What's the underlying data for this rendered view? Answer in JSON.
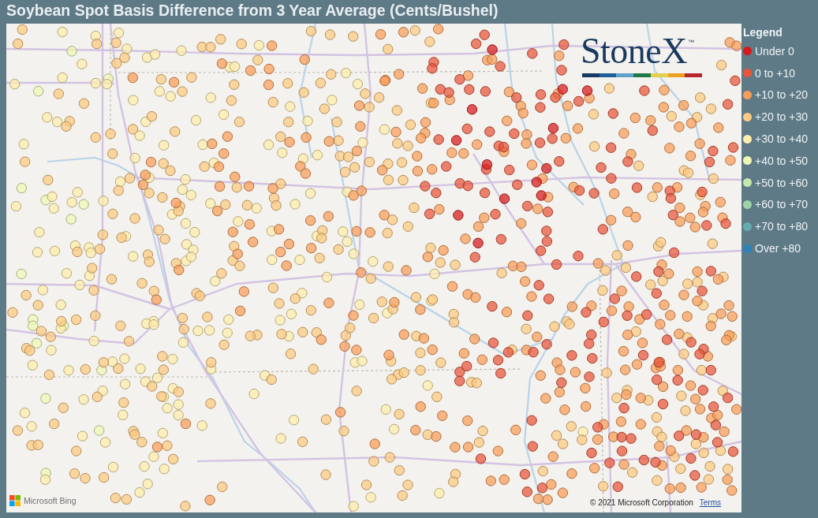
{
  "title": "Soybean Spot Basis Difference from 3 Year Average (Cents/Bushel)",
  "map": {
    "logo": {
      "wordmark": "StoneX",
      "trademark": "™"
    },
    "attribution": {
      "provider": "Microsoft Bing",
      "copyright": "© 2021 Microsoft Corporation",
      "link": "Terms"
    }
  },
  "legend": {
    "title": "Legend",
    "items": [
      {
        "label": "Under 0",
        "color": "#d7191c"
      },
      {
        "label": "0 to +10",
        "color": "#e8553a"
      },
      {
        "label": "+10 to +20",
        "color": "#f99d59"
      },
      {
        "label": "+20 to +30",
        "color": "#fec980"
      },
      {
        "label": "+30 to +40",
        "color": "#ffedaa"
      },
      {
        "label": "+40 to +50",
        "color": "#eef8b4"
      },
      {
        "label": "+50 to +60",
        "color": "#c7e8ad"
      },
      {
        "label": "+60 to +70",
        "color": "#9dd3a7"
      },
      {
        "label": "+70 to +80",
        "color": "#64abb0"
      },
      {
        "label": "Over +80",
        "color": "#2b83ba"
      }
    ]
  }
}
